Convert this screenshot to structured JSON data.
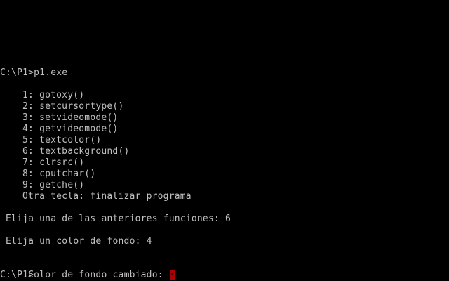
{
  "terminal": {
    "command_line": "C:\\P1>p1.exe",
    "menu": [
      "1: gotoxy()",
      "2: setcursortype()",
      "3: setvideomode()",
      "4: getvideomode()",
      "5: textcolor()",
      "6: textbackground()",
      "7: clrsrc()",
      "8: cputchar()",
      "9: getche()",
      "Otra tecla: finalizar programa"
    ],
    "prompt_function": "Elija una de las anteriores funciones: 6",
    "prompt_color": "Elija un color de fondo: 4",
    "result_message": "Color de fondo cambiado: ",
    "cursor_char": "×",
    "final_prompt": "C:\\P1>"
  },
  "colors": {
    "background": "#000000",
    "text": "#c0c0c0",
    "changed_background": "#b00000"
  }
}
